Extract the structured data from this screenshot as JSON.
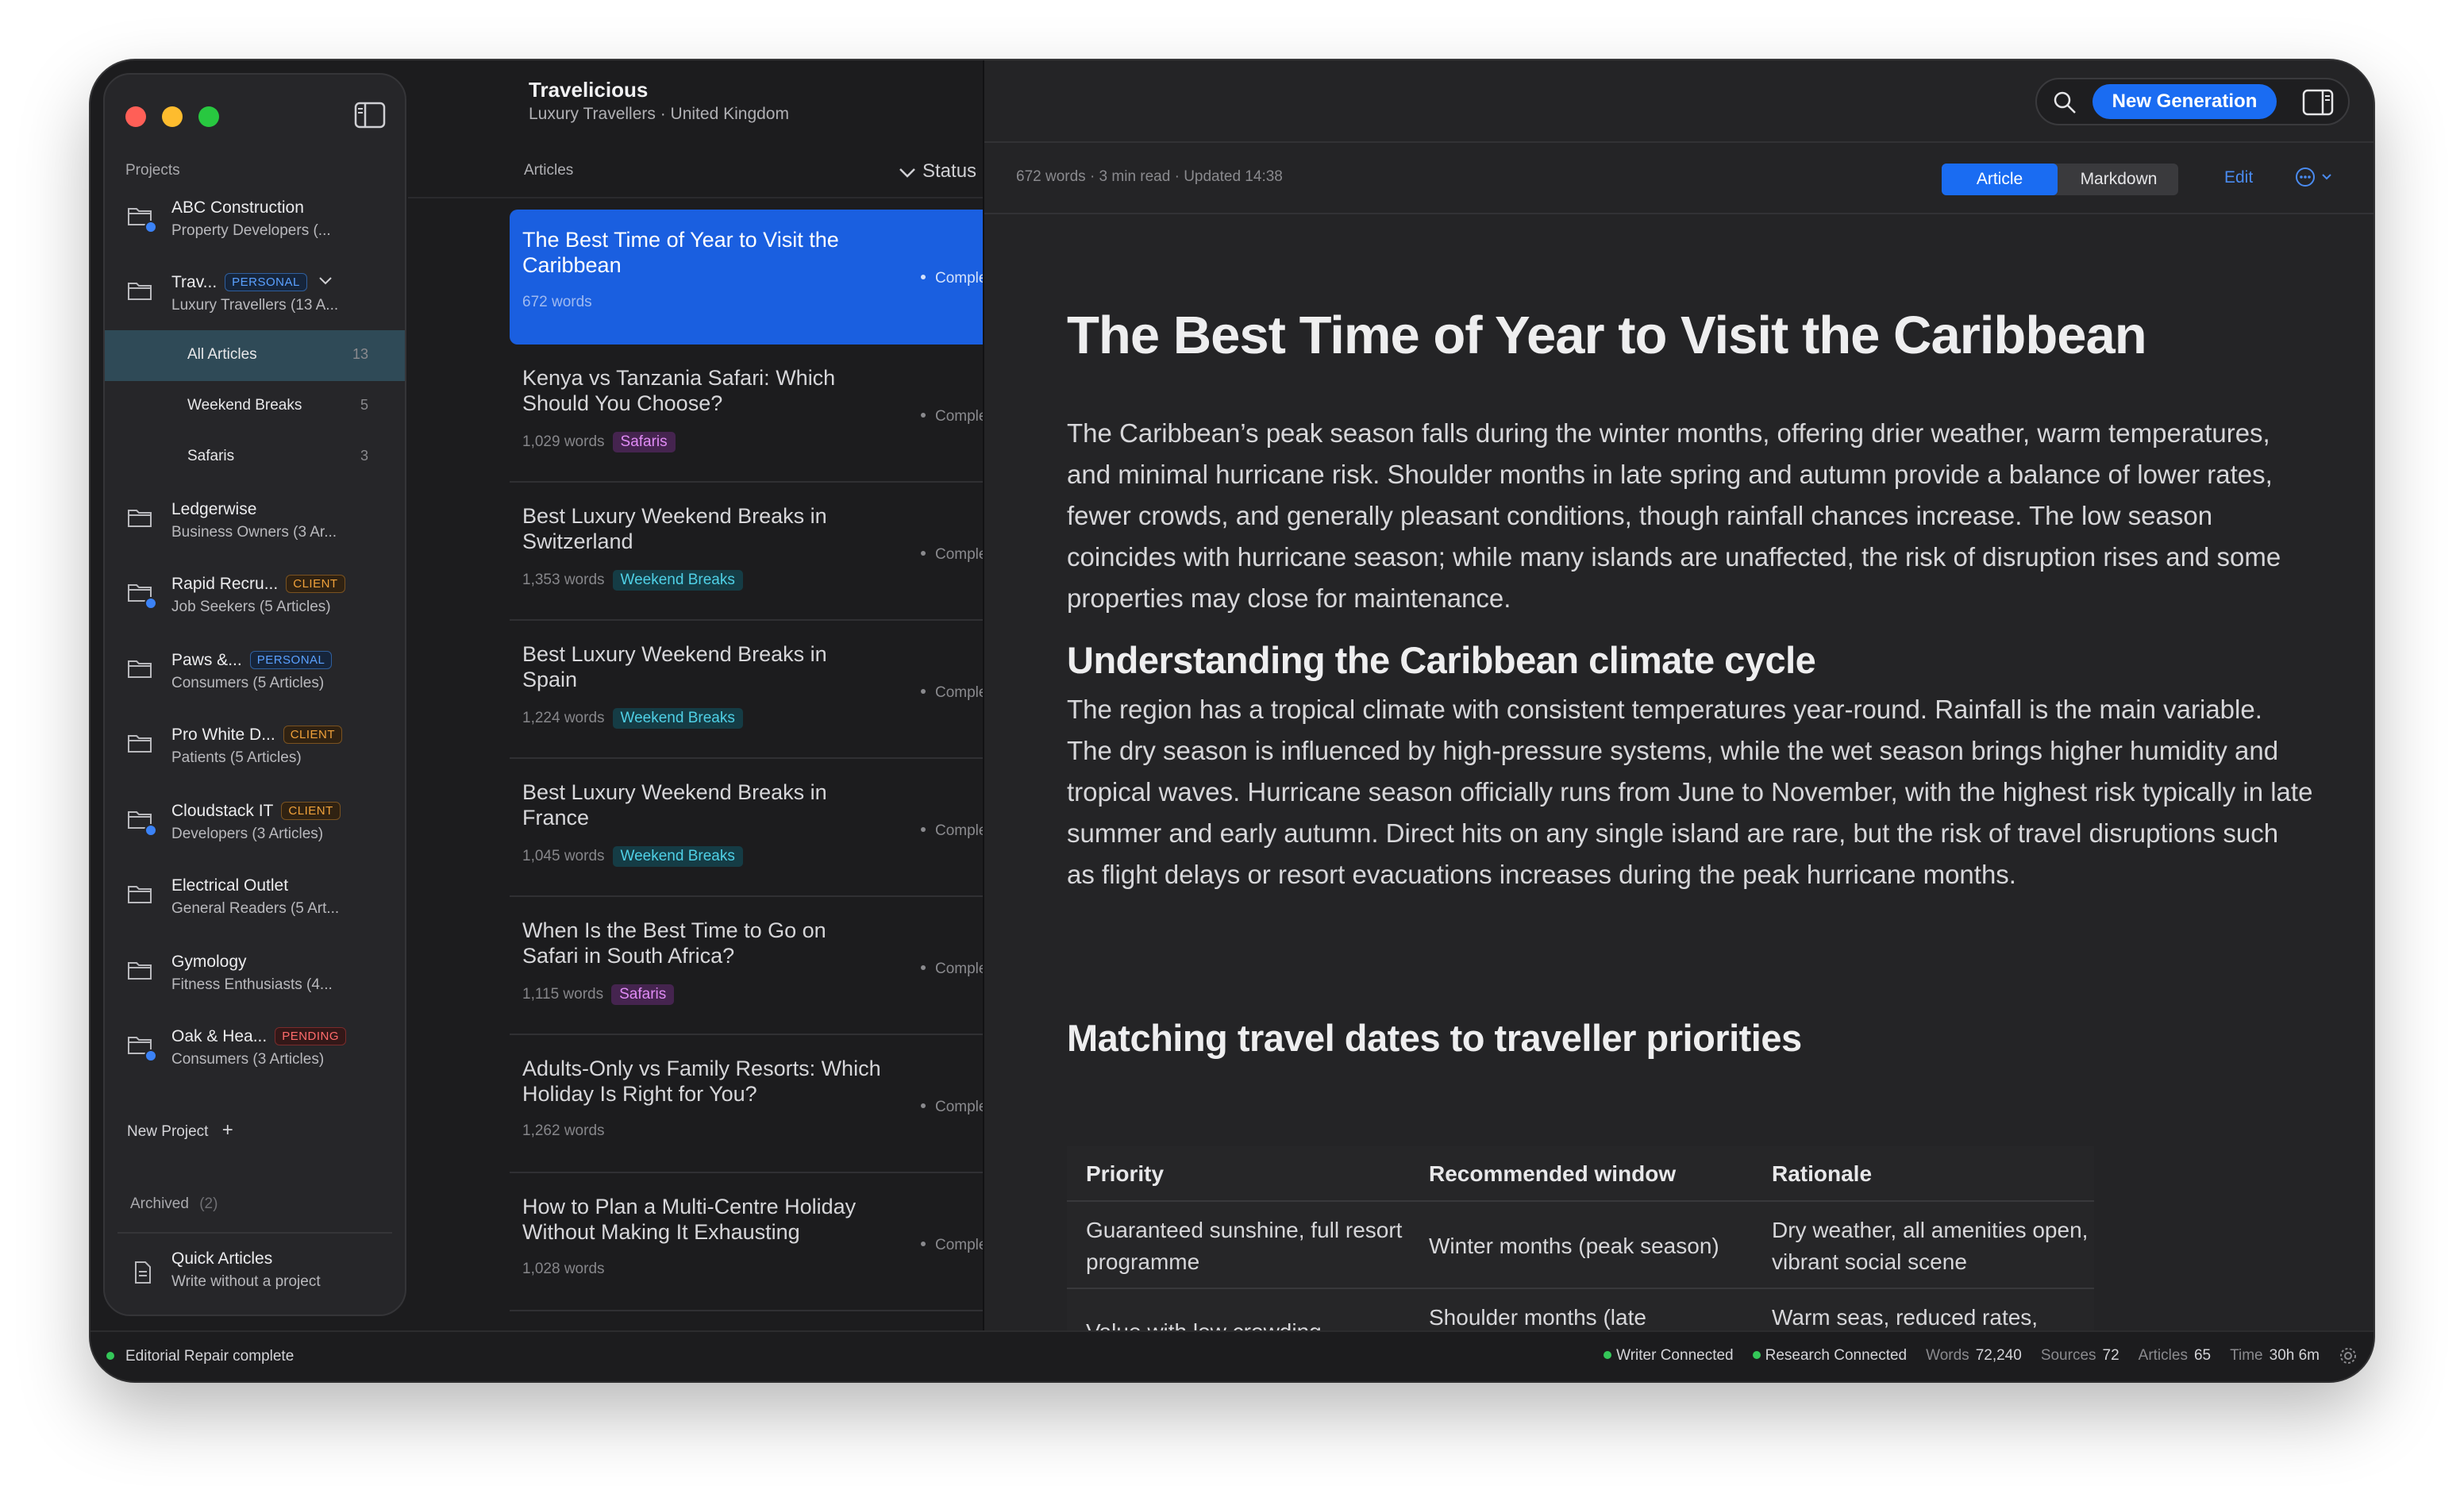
{
  "sidebar": {
    "section_label": "Projects",
    "projects": [
      {
        "name": "ABC Construction",
        "sub": "Property Developers (...",
        "badge": "",
        "badge_type": ""
      },
      {
        "name": "Trav...",
        "sub": "Luxury Travellers (13 A...",
        "badge": "PERSONAL",
        "badge_type": "personal"
      },
      {
        "name": "Ledgerwise",
        "sub": "Business Owners (3 Ar...",
        "badge": "",
        "badge_type": ""
      },
      {
        "name": "Rapid Recru...",
        "sub": "Job Seekers (5 Articles)",
        "badge": "CLIENT",
        "badge_type": "client"
      },
      {
        "name": "Paws &...",
        "sub": "Consumers (5 Articles)",
        "badge": "PERSONAL",
        "badge_type": "personal"
      },
      {
        "name": "Pro White D...",
        "sub": "Patients (5 Articles)",
        "badge": "CLIENT",
        "badge_type": "client"
      },
      {
        "name": "Cloudstack IT",
        "sub": "Developers (3 Articles)",
        "badge": "CLIENT",
        "badge_type": "client"
      },
      {
        "name": "Electrical Outlet",
        "sub": "General Readers (5 Art...",
        "badge": "",
        "badge_type": ""
      },
      {
        "name": "Gymology",
        "sub": "Fitness Enthusiasts (4...",
        "badge": "",
        "badge_type": ""
      },
      {
        "name": "Oak & Hea...",
        "sub": "Consumers (3 Articles)",
        "badge": "PENDING",
        "badge_type": "pending"
      }
    ],
    "subitems": [
      {
        "label": "All Articles",
        "count": "13"
      },
      {
        "label": "Weekend Breaks",
        "count": "5"
      },
      {
        "label": "Safaris",
        "count": "3"
      }
    ],
    "new_project": "New Project",
    "archived_label": "Archived",
    "archived_count": "(2)",
    "quick_title": "Quick Articles",
    "quick_sub": "Write without a project"
  },
  "list": {
    "project_title": "Travelicious",
    "project_sub": "Luxury Travellers · United Kingdom",
    "col_articles": "Articles",
    "col_status": "Status",
    "articles": [
      {
        "title": "The Best Time of Year to Visit the Caribbean",
        "words": "672 words",
        "tag": "",
        "status": "Complete"
      },
      {
        "title": "Kenya vs Tanzania Safari: Which Should You Choose?",
        "words": "1,029 words",
        "tag": "Safaris",
        "status": "Complete"
      },
      {
        "title": "Best Luxury Weekend Breaks in Switzerland",
        "words": "1,353 words",
        "tag": "Weekend Breaks",
        "status": "Complete"
      },
      {
        "title": "Best Luxury Weekend Breaks in Spain",
        "words": "1,224 words",
        "tag": "Weekend Breaks",
        "status": "Complete"
      },
      {
        "title": "Best Luxury Weekend Breaks in France",
        "words": "1,045 words",
        "tag": "Weekend Breaks",
        "status": "Complete"
      },
      {
        "title": "When Is the Best Time to Go on Safari in South Africa?",
        "words": "1,115 words",
        "tag": "Safaris",
        "status": "Complete"
      },
      {
        "title": "Adults-Only vs Family Resorts: Which Holiday Is Right for You?",
        "words": "1,262 words",
        "tag": "",
        "status": "Complete"
      },
      {
        "title": "How to Plan a Multi-Centre Holiday Without Making It Exhausting",
        "words": "1,028 words",
        "tag": "",
        "status": "Complete"
      }
    ]
  },
  "toolbar": {
    "search_icon": "search-icon",
    "new_generation": "New Generation",
    "panel_icon": "panel-right-icon"
  },
  "meta": {
    "info": "672 words · 3 min read · Updated 14:38",
    "view_article": "Article",
    "view_markdown": "Markdown",
    "edit": "Edit"
  },
  "article": {
    "title": "The Best Time of Year to Visit the Caribbean",
    "p1": "The Caribbean’s peak season falls during the winter months, offering drier weather, warm temperatures, and minimal hurricane risk. Shoulder months in late spring and autumn provide a balance of lower rates, fewer crowds, and generally pleasant conditions, though rainfall chances increase. The low season coincides with hurricane season; while many islands are unaffected, the risk of disruption rises and some properties may close for maintenance.",
    "h2a": "Understanding the Caribbean climate cycle",
    "p2": "The region has a tropical climate with consistent temperatures year-round. Rainfall is the main variable. The dry season is influenced by high-pressure systems, while the wet season brings higher humidity and tropical waves. Hurricane season officially runs from June to November, with the highest risk typically in late summer and early autumn. Direct hits on any single island are rare, but the risk of travel disruptions such as flight delays or resort evacuations increases during the peak hurricane months.",
    "h2b": "Matching travel dates to traveller priorities",
    "table": {
      "headers": [
        "Priority",
        "Recommended window",
        "Rationale"
      ],
      "rows": [
        [
          "Guaranteed sunshine, full resort programme",
          "Winter months (peak season)",
          "Dry weather, all amenities open, vibrant social scene"
        ],
        [
          "Value with low crowding",
          "Shoulder months (late",
          "Warm seas, reduced rates,"
        ]
      ]
    }
  },
  "statusbar": {
    "left": "Editorial Repair complete",
    "writer": "Writer Connected",
    "research": "Research Connected",
    "words_label": "Words",
    "words": "72,240",
    "sources_label": "Sources",
    "sources": "72",
    "articles_label": "Articles",
    "articles": "65",
    "time_label": "Time",
    "time": "30h 6m"
  },
  "colors": {
    "accent": "#1a6cf2",
    "selected_card": "#1a5fe0",
    "connected": "#34c759",
    "client_badge": "#f0a13a",
    "personal_badge": "#5aa0ff",
    "pending_badge": "#ff6b6b",
    "tag_safari": "#e08bf5",
    "tag_weekend": "#4fd0e6"
  }
}
